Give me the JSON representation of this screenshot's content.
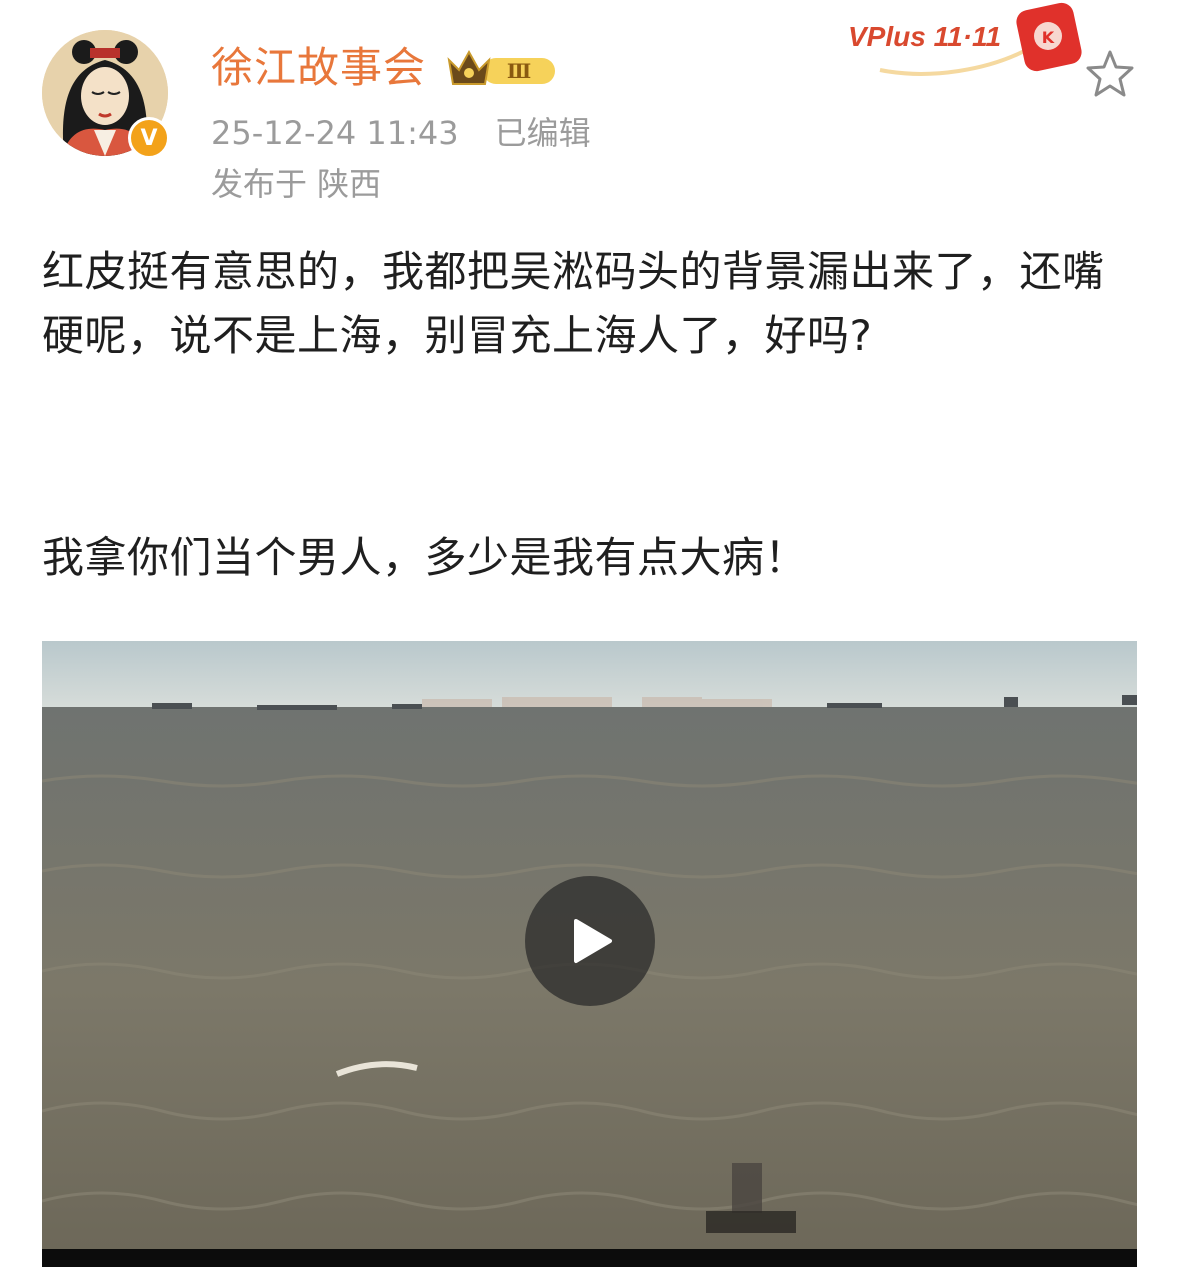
{
  "post": {
    "author": {
      "name": "徐江故事会",
      "level_badge": "Ⅲ",
      "verified_mark": "V"
    },
    "timestamp": "25-12-24 11:43",
    "edited": "已编辑",
    "location": "发布于 陕西",
    "promo_badge": "VPlus 11·11",
    "text_paragraph_1": "红皮挺有意思的，我都把吴淞码头的背景漏出来了，还嘴硬呢，说不是上海，别冒充上海人了，好吗?",
    "text_paragraph_2": "我拿你们当个男人，多少是我有点大病！",
    "video": {
      "has_play_button": true
    }
  },
  "icons": {
    "favorite": "star-outline-icon",
    "play": "play-icon",
    "verified": "verified-v-icon",
    "crown": "crown-icon"
  },
  "colors": {
    "username": "#e8773b",
    "meta_text": "#9b9b9b",
    "body_text": "#1f1f1f",
    "verified_badge": "#f3a21a",
    "vplus_red": "#e0312b"
  }
}
